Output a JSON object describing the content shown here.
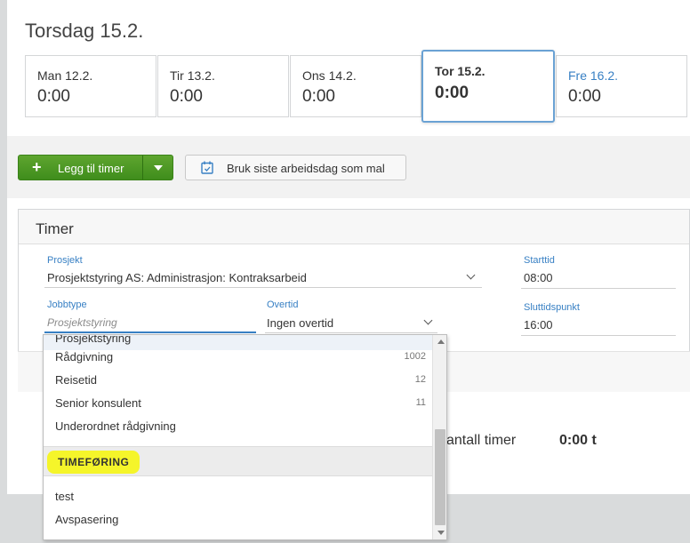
{
  "page_title": "Torsdag 15.2.",
  "days": [
    {
      "label": "Man 12.2.",
      "value": "0:00"
    },
    {
      "label": "Tir 13.2.",
      "value": "0:00"
    },
    {
      "label": "Ons 14.2.",
      "value": "0:00"
    },
    {
      "label": "Tor 15.2.",
      "value": "0:00",
      "selected": true
    },
    {
      "label": "Fre 16.2.",
      "value": "0:00"
    }
  ],
  "toolbar": {
    "add_label": "Legg til timer",
    "template_label": "Bruk siste arbeidsdag som mal"
  },
  "panel": {
    "title": "Timer",
    "prosjekt_label": "Prosjekt",
    "prosjekt_value": "Prosjektstyring AS: Administrasjon: Kontraksarbeid",
    "jobbtype_label": "Jobbtype",
    "jobbtype_placeholder": "Prosjektstyring",
    "overtid_label": "Overtid",
    "overtid_value": "Ingen overtid",
    "starttid_label": "Starttid",
    "starttid_value": "08:00",
    "sluttid_label": "Sluttidspunkt",
    "sluttid_value": "16:00"
  },
  "summary": {
    "antall_label": "antall timer",
    "antall_value": "0:00 t"
  },
  "dropdown": {
    "partial_item": "Prosjektstyring",
    "items": [
      {
        "label": "Rådgivning",
        "count": "1002"
      },
      {
        "label": "Reisetid",
        "count": "12"
      },
      {
        "label": "Senior konsulent",
        "count": "11"
      },
      {
        "label": "Underordnet rådgivning",
        "count": ""
      }
    ],
    "group_label": "TIMEFØRING",
    "group_items": [
      {
        "label": "test"
      },
      {
        "label": "Avspasering"
      }
    ]
  },
  "colors": {
    "accent_blue": "#3880c4",
    "primary_green": "#4a9a24",
    "highlight_yellow": "#f5f52a"
  }
}
